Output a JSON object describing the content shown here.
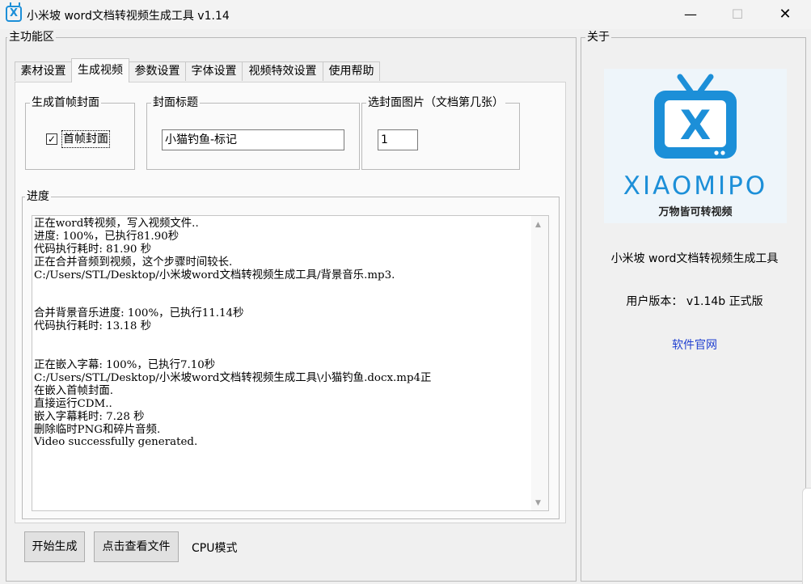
{
  "window": {
    "title": "小米坡 word文档转视频生成工具 v1.14",
    "controls": {
      "minimize": "—",
      "maximize": "☐",
      "close": "✕"
    }
  },
  "main_area": {
    "label": "主功能区",
    "tabs": [
      "素材设置",
      "生成视频",
      "参数设置",
      "字体设置",
      "视频特效设置",
      "使用帮助"
    ],
    "active_tab": "生成视频",
    "cover_group": {
      "label": "生成首帧封面",
      "checkbox_label": "首帧封面",
      "checked": true,
      "check_mark": "✓"
    },
    "title_group": {
      "label": "封面标题",
      "value": "小猫钓鱼-标记"
    },
    "image_group": {
      "label": "选封面图片（文档第几张）",
      "value": "1"
    },
    "progress": {
      "label": "进度",
      "log_lines": [
        "正在word转视频，写入视频文件..",
        "进度: 100%，已执行81.90秒",
        "代码执行耗时: 81.90 秒",
        "正在合并音频到视频，这个步骤时间较长.",
        "C:/Users/STL/Desktop/小米坡word文档转视频生成工具/背景音乐.mp3.",
        "",
        "",
        "合并背景音乐进度: 100%，已执行11.14秒",
        "代码执行耗时: 13.18 秒",
        "",
        "",
        "正在嵌入字幕: 100%，已执行7.10秒",
        "C:/Users/STL/Desktop/小米坡word文档转视频生成工具\\小猫钓鱼.docx.mp4正",
        "在嵌入首帧封面.",
        "直接运行CDM..",
        "嵌入字幕耗时: 7.28 秒",
        "删除临时PNG和碎片音频.",
        "Video successfully generated."
      ]
    },
    "buttons": {
      "start": "开始生成",
      "view_file": "点击查看文件"
    },
    "mode_label": "CPU模式"
  },
  "about": {
    "label": "关于",
    "logo": {
      "brand": "XIAOMIPO",
      "slogan": "万物皆可转视频",
      "letter": "X"
    },
    "app_name": "小米坡 word文档转视频生成工具",
    "version": "用户版本： v1.14b 正式版",
    "website_link": "软件官网"
  },
  "colors": {
    "logo_blue": "#1c8fd8",
    "link": "#1f3fd0",
    "window_bg": "#f0f0f0"
  }
}
